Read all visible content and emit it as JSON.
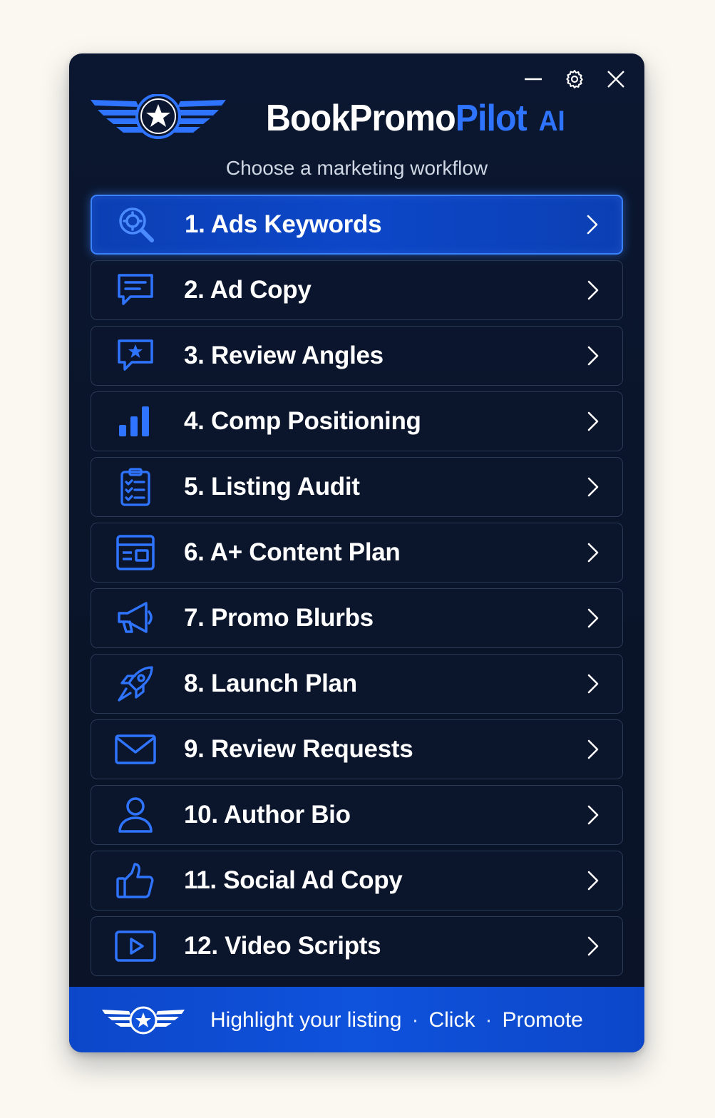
{
  "window": {
    "controls": [
      "minimize-icon",
      "gear-icon",
      "close-icon"
    ]
  },
  "header": {
    "brand_part1": "BookPromo",
    "brand_part2": "Pilot",
    "brand_part3": "AI",
    "subtitle": "Choose a marketing workflow"
  },
  "menu": {
    "items": [
      {
        "label": "1.  Ads Keywords",
        "icon": "search-icon",
        "active": true
      },
      {
        "label": "2.  Ad Copy",
        "icon": "chat-bubble-icon",
        "active": false
      },
      {
        "label": "3.  Review Angles",
        "icon": "star-bubble-icon",
        "active": false
      },
      {
        "label": "4.  Comp Positioning",
        "icon": "bar-chart-icon",
        "active": false
      },
      {
        "label": "5.  Listing Audit",
        "icon": "clipboard-check-icon",
        "active": false
      },
      {
        "label": "6.  A+ Content Plan",
        "icon": "layout-icon",
        "active": false
      },
      {
        "label": "7.  Promo Blurbs",
        "icon": "megaphone-icon",
        "active": false
      },
      {
        "label": "8.  Launch Plan",
        "icon": "rocket-icon",
        "active": false
      },
      {
        "label": "9.  Review Requests",
        "icon": "envelope-icon",
        "active": false
      },
      {
        "label": "10.  Author Bio",
        "icon": "user-icon",
        "active": false
      },
      {
        "label": "11.  Social Ad Copy",
        "icon": "thumbs-up-icon",
        "active": false
      },
      {
        "label": "12.  Video Scripts",
        "icon": "video-play-icon",
        "active": false
      }
    ]
  },
  "footer": {
    "text1": "Highlight your listing",
    "text2": "Click",
    "text3": "Promote",
    "separator": "·"
  },
  "colors": {
    "accent": "#2f74ff",
    "active_bg": "#0d47c8",
    "window_bg": "#0b1730",
    "footer_bg": "#0f52dc"
  }
}
